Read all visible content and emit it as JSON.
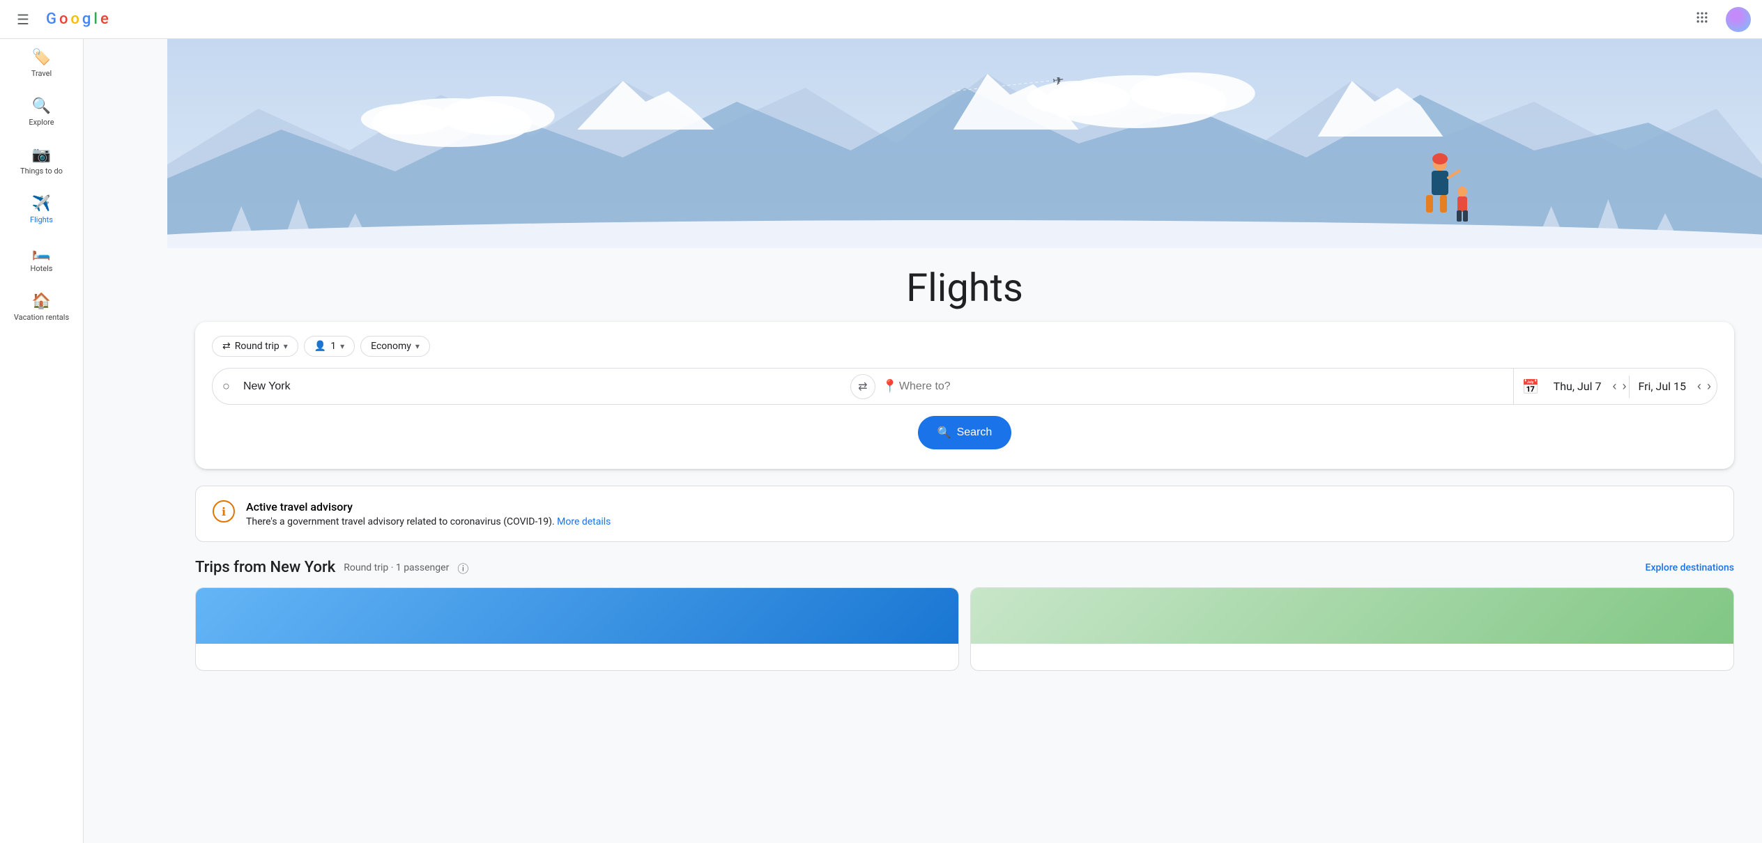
{
  "topbar": {
    "menu_label": "☰",
    "logo_text": "Google",
    "apps_icon": "⠿",
    "avatar_alt": "User avatar"
  },
  "sidebar": {
    "items": [
      {
        "id": "travel",
        "label": "Travel",
        "icon": "🏷️",
        "active": false
      },
      {
        "id": "explore",
        "label": "Explore",
        "icon": "🔍",
        "active": false
      },
      {
        "id": "things-to-do",
        "label": "Things to do",
        "icon": "📷",
        "active": false
      },
      {
        "id": "flights",
        "label": "Flights",
        "icon": "✈️",
        "active": true
      },
      {
        "id": "hotels",
        "label": "Hotels",
        "icon": "🛏️",
        "active": false
      },
      {
        "id": "vacation-rentals",
        "label": "Vacation rentals",
        "icon": "🏠",
        "active": false
      }
    ]
  },
  "hero": {
    "title": "Flights",
    "airplane_icon": "✈"
  },
  "search": {
    "trip_type": "Round trip",
    "passengers": "1",
    "cabin_class": "Economy",
    "origin": "New York",
    "destination_placeholder": "Where to?",
    "date_from": "Thu, Jul 7",
    "date_to": "Fri, Jul 15",
    "search_label": "Search",
    "swap_icon": "⇄"
  },
  "advisory": {
    "title": "Active travel advisory",
    "description": "There's a government travel advisory related to coronavirus (COVID-19).",
    "link_text": "More details"
  },
  "trips": {
    "title": "Trips from New York",
    "subtitle": "Round trip · 1 passenger",
    "info_icon": "ⓘ",
    "explore_label": "Explore destinations"
  }
}
